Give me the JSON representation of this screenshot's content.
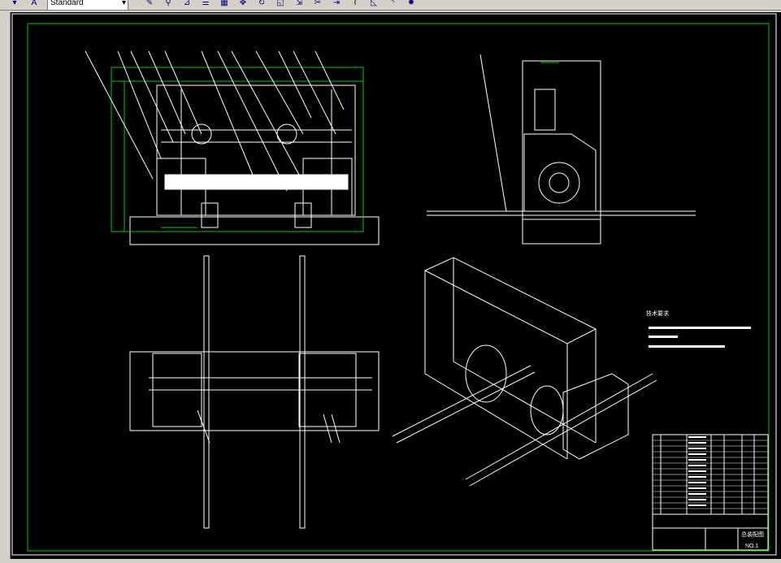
{
  "toolbar": {
    "text_style_value": "Standard",
    "icons": [
      "pencil-icon",
      "link-icon",
      "mirror-icon",
      "list-icon",
      "grid-icon",
      "move-icon",
      "rotate-icon",
      "scale-icon",
      "stretch-icon",
      "trim-icon",
      "extend-icon",
      "break-icon",
      "chamfer-icon",
      "fillet-icon",
      "explode-icon"
    ]
  },
  "drawing": {
    "tech_requirements_label": "技术要求",
    "title_block_name": "总装配图",
    "title_block_number": "NO.1"
  },
  "colors": {
    "background": "#000000",
    "border": "#00c800",
    "lines": "#ffffff",
    "dimensions": "#00c800"
  }
}
